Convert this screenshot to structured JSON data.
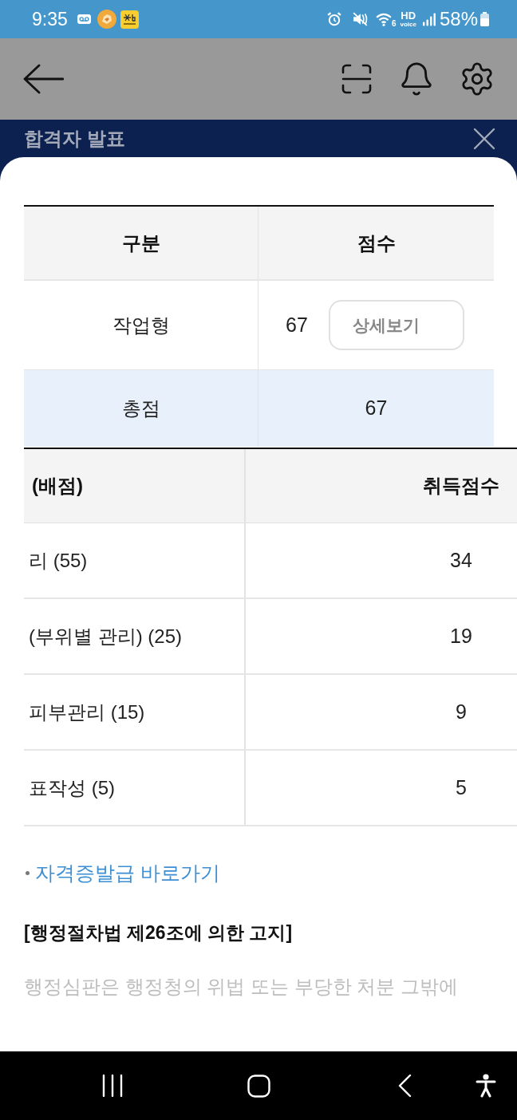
{
  "status_bar": {
    "time": "9:35",
    "wifi_badge": "6",
    "hd_label": "HD",
    "voice_label": "voice",
    "battery": "58%"
  },
  "banner": {
    "title": "합격자 발표"
  },
  "score_table": {
    "columns": [
      "구분",
      "점수"
    ],
    "rows": [
      {
        "kind": "item",
        "label": "작업형",
        "score": "67",
        "button": "상세보기"
      },
      {
        "kind": "total",
        "label": "총점",
        "score": "67"
      }
    ]
  },
  "detail_table": {
    "columns": [
      "(배점)",
      "취득점수"
    ],
    "rows": [
      {
        "item": "리 (55)",
        "score": "34"
      },
      {
        "item": "(부위별 관리) (25)",
        "score": "19"
      },
      {
        "item": "피부관리 (15)",
        "score": "9"
      },
      {
        "item": "표작성 (5)",
        "score": "5"
      }
    ]
  },
  "link": {
    "label": "자격증발급 바로가기"
  },
  "notice": {
    "title": "[행정절차법 제26조에 의한 고지]",
    "body": "행정심판은 행정청의 위법 또는 부당한 처분 그밖에"
  }
}
